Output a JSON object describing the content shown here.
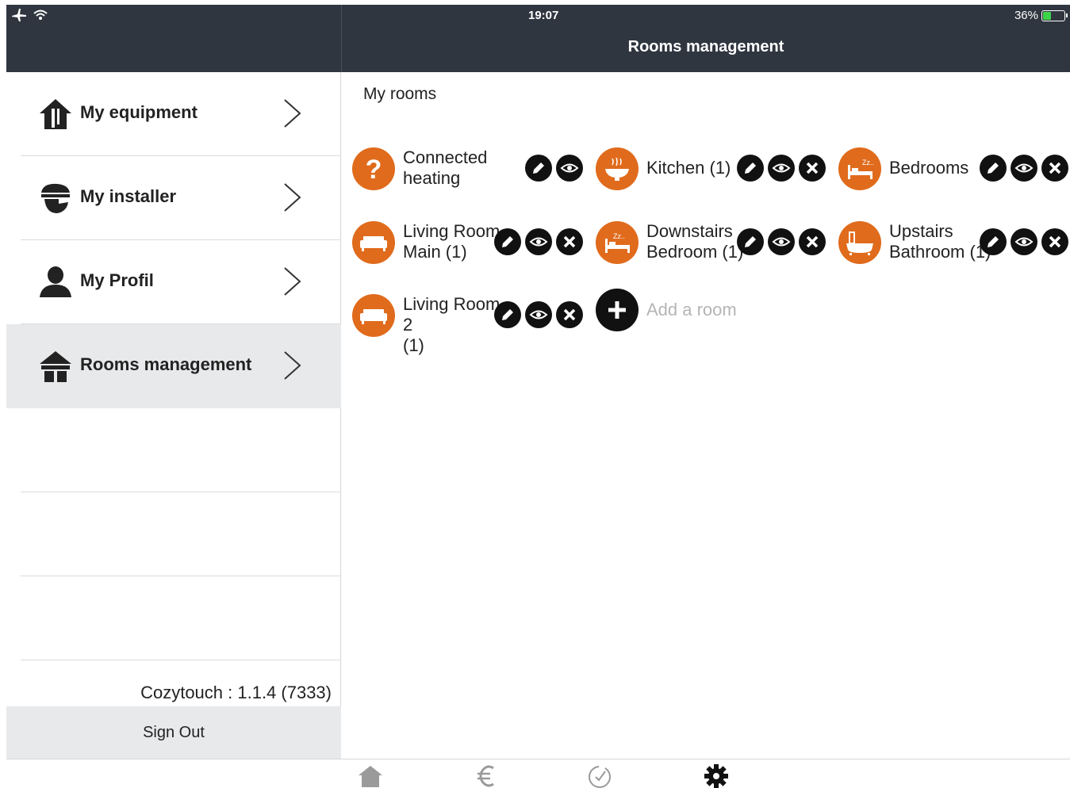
{
  "status_bar": {
    "time": "19:07",
    "battery_percent": "36%",
    "battery_level": 0.36,
    "icons": [
      "airplane-icon",
      "wifi-icon"
    ]
  },
  "nav": {
    "title": "Rooms management"
  },
  "sidebar": {
    "items": [
      {
        "label": "My equipment",
        "icon": "equipment-icon"
      },
      {
        "label": "My installer",
        "icon": "installer-icon"
      },
      {
        "label": "My Profil",
        "icon": "profile-icon"
      },
      {
        "label": "Rooms management",
        "icon": "house-icon",
        "active": true
      }
    ],
    "version": "Cozytouch : 1.1.4 (7333)",
    "sign_out": "Sign Out"
  },
  "main": {
    "section_title": "My rooms",
    "rooms": [
      {
        "name": "Connected\nheating",
        "icon": "question-icon"
      },
      {
        "name": "Kitchen  (1)",
        "icon": "cooking-pot-icon"
      },
      {
        "name": "Bedrooms",
        "icon": "bed-icon"
      },
      {
        "name": "Living Room\nMain (1)",
        "icon": "sofa-icon"
      },
      {
        "name": "Downstairs\nBedroom (1)",
        "icon": "bed-icon"
      },
      {
        "name": "Upstairs\nBathroom  (1)",
        "icon": "bathtub-icon"
      },
      {
        "name": "Living Room 2\n(1)",
        "icon": "sofa-icon"
      }
    ],
    "add_room_label": "Add a room"
  },
  "tabbar": {
    "tabs": [
      "home-tab-icon",
      "euro-tab-icon",
      "timer-tab-icon",
      "settings-tab-icon"
    ],
    "active": "settings-tab-icon",
    "colors": {
      "inactive": "#9a9a9a",
      "active": "#111111"
    }
  },
  "colors": {
    "accent": "#e06b1c",
    "header": "#2f3640",
    "active_row": "#e8e9eb"
  }
}
